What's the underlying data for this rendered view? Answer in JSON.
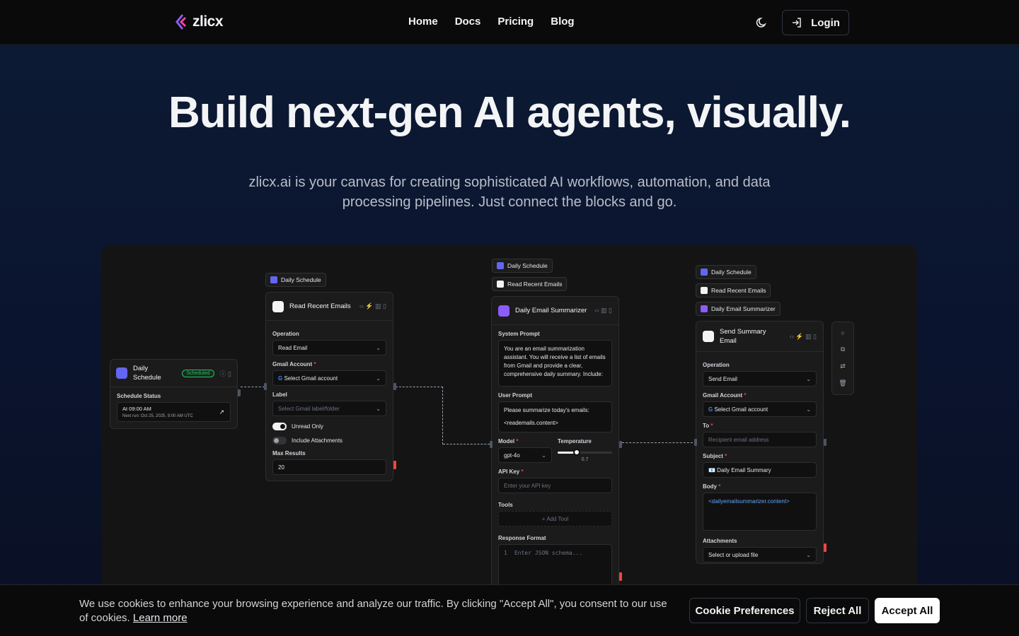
{
  "header": {
    "logo_text": "zlicx",
    "nav": [
      "Home",
      "Docs",
      "Pricing",
      "Blog"
    ],
    "login_label": "Login"
  },
  "hero": {
    "title": "Build next-gen AI agents, visually.",
    "subtitle": "zlicx.ai is your canvas for creating sophisticated AI workflows, automation, and data processing pipelines. Just connect the blocks and go."
  },
  "workflow": {
    "chips": {
      "daily_schedule": "Daily Schedule",
      "read_recent_emails": "Read Recent Emails",
      "daily_email_summarizer": "Daily Email Summarizer"
    },
    "schedule_node": {
      "title": "Daily Schedule",
      "badge": "Scheduled",
      "status_label": "Schedule Status",
      "time": "At 09:00 AM",
      "next_run": "Next run: Oct 25, 2025, 9:00 AM UTC"
    },
    "read_node": {
      "title": "Read Recent Emails",
      "operation_label": "Operation",
      "operation_value": "Read Email",
      "gmail_label": "Gmail Account",
      "gmail_value": "Select Gmail account",
      "label_label": "Label",
      "label_placeholder": "Select Gmail label/folder",
      "unread_only": "Unread Only",
      "include_attachments": "Include Attachments",
      "max_results_label": "Max Results",
      "max_results_value": "20"
    },
    "summarizer_node": {
      "title": "Daily Email Summarizer",
      "system_prompt_label": "System Prompt",
      "system_prompt_value": "You are an email summarization assistant. You will receive a list of emails from Gmail and provide a clear, comprehensive daily summary. Include:",
      "user_prompt_label": "User Prompt",
      "user_prompt_line1": "Please summarize today's emails:",
      "user_prompt_line2": "<reademails.content>",
      "model_label": "Model",
      "model_value": "gpt-4o",
      "temperature_label": "Temperature",
      "temperature_value": "0.7",
      "temperature_fraction": 0.35,
      "api_key_label": "API Key",
      "api_key_placeholder": "Enter your API key",
      "tools_label": "Tools",
      "add_tool": "Add Tool",
      "response_format_label": "Response Format",
      "response_line_no": "1",
      "response_placeholder": "Enter JSON schema..."
    },
    "send_node": {
      "title": "Send Summary Email",
      "operation_label": "Operation",
      "operation_value": "Send Email",
      "gmail_label": "Gmail Account",
      "gmail_value": "Select Gmail account",
      "to_label": "To",
      "to_placeholder": "Recipient email address",
      "subject_label": "Subject",
      "subject_value": "📧 Daily Email Summary",
      "body_label": "Body",
      "body_value": "<dailyemailsummarizer.content>",
      "attachments_label": "Attachments",
      "attachments_value": "Select or upload file"
    }
  },
  "cookie": {
    "text": "We use cookies to enhance your browsing experience and analyze our traffic. By clicking \"Accept All\", you consent to our use of cookies.",
    "learn_more": "Learn more",
    "preferences": "Cookie Preferences",
    "reject": "Reject All",
    "accept": "Accept All"
  },
  "colors": {
    "accent_schedule": "#6366f1",
    "accent_ai": "#8b5cf6",
    "scheduled_green": "#22c55e",
    "error_red": "#ef4444"
  }
}
